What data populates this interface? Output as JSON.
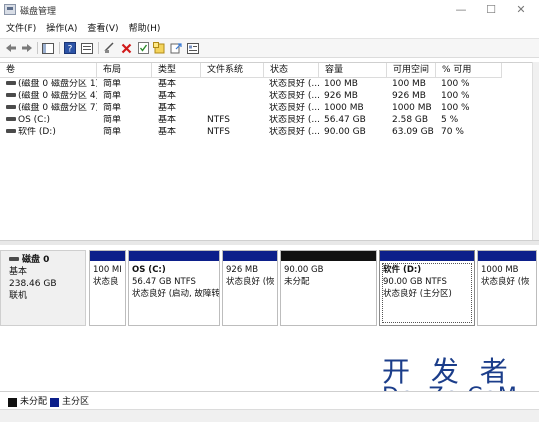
{
  "window": {
    "title": "磁盘管理",
    "minimize": "—",
    "maximize": "☐",
    "close": "✕"
  },
  "menu": [
    "文件(F)",
    "操作(A)",
    "查看(V)",
    "帮助(H)"
  ],
  "toolbar": [
    "back-icon",
    "forward-icon",
    "console-tree-icon",
    "help-icon",
    "properties-icon",
    "connect-icon",
    "delete-icon",
    "check-icon",
    "new-folder-icon",
    "export-icon",
    "settings-icon"
  ],
  "columns": [
    "卷",
    "布局",
    "类型",
    "文件系统",
    "状态",
    "容量",
    "可用空间",
    "% 可用"
  ],
  "volumes": [
    {
      "name": "(磁盘 0 磁盘分区 1)",
      "layout": "简单",
      "type": "基本",
      "fs": "",
      "status": "状态良好 (...",
      "capacity": "100 MB",
      "free": "100 MB",
      "pct": "100 %"
    },
    {
      "name": "(磁盘 0 磁盘分区 4)",
      "layout": "简单",
      "type": "基本",
      "fs": "",
      "status": "状态良好 (...",
      "capacity": "926 MB",
      "free": "926 MB",
      "pct": "100 %"
    },
    {
      "name": "(磁盘 0 磁盘分区 7)",
      "layout": "简单",
      "type": "基本",
      "fs": "",
      "status": "状态良好 (...",
      "capacity": "1000 MB",
      "free": "1000 MB",
      "pct": "100 %"
    },
    {
      "name": "OS (C:)",
      "layout": "简单",
      "type": "基本",
      "fs": "NTFS",
      "status": "状态良好 (...",
      "capacity": "56.47 GB",
      "free": "2.58 GB",
      "pct": "5 %"
    },
    {
      "name": "软件 (D:)",
      "layout": "简单",
      "type": "基本",
      "fs": "NTFS",
      "status": "状态良好 (...",
      "capacity": "90.00 GB",
      "free": "63.09 GB",
      "pct": "70 %"
    }
  ],
  "disk": {
    "name": "磁盘 0",
    "type": "基本",
    "size": "238.46 GB",
    "state": "联机"
  },
  "partitions": [
    {
      "name": "",
      "line1": "100 MI",
      "line2": "状态良",
      "kind": "primary"
    },
    {
      "name": "OS (C:)",
      "line1": "56.47 GB NTFS",
      "line2": "状态良好 (启动, 故障转",
      "kind": "primary"
    },
    {
      "name": "",
      "line1": "926 MB",
      "line2": "状态良好 (恢",
      "kind": "primary"
    },
    {
      "name": "",
      "line1": "90.00 GB",
      "line2": "未分配",
      "kind": "unallocated"
    },
    {
      "name": "软件 (D:)",
      "line1": "90.00 GB NTFS",
      "line2": "状态良好 (主分区)",
      "kind": "primary"
    },
    {
      "name": "",
      "line1": "1000 MB",
      "line2": "状态良好 (恢",
      "kind": "primary"
    }
  ],
  "legend": [
    {
      "label": "未分配",
      "color": "#111111"
    },
    {
      "label": "主分区",
      "color": "#0c1f8a"
    }
  ],
  "watermark": {
    "top": "开 发 者",
    "bottom": "DevZe.CoM"
  }
}
